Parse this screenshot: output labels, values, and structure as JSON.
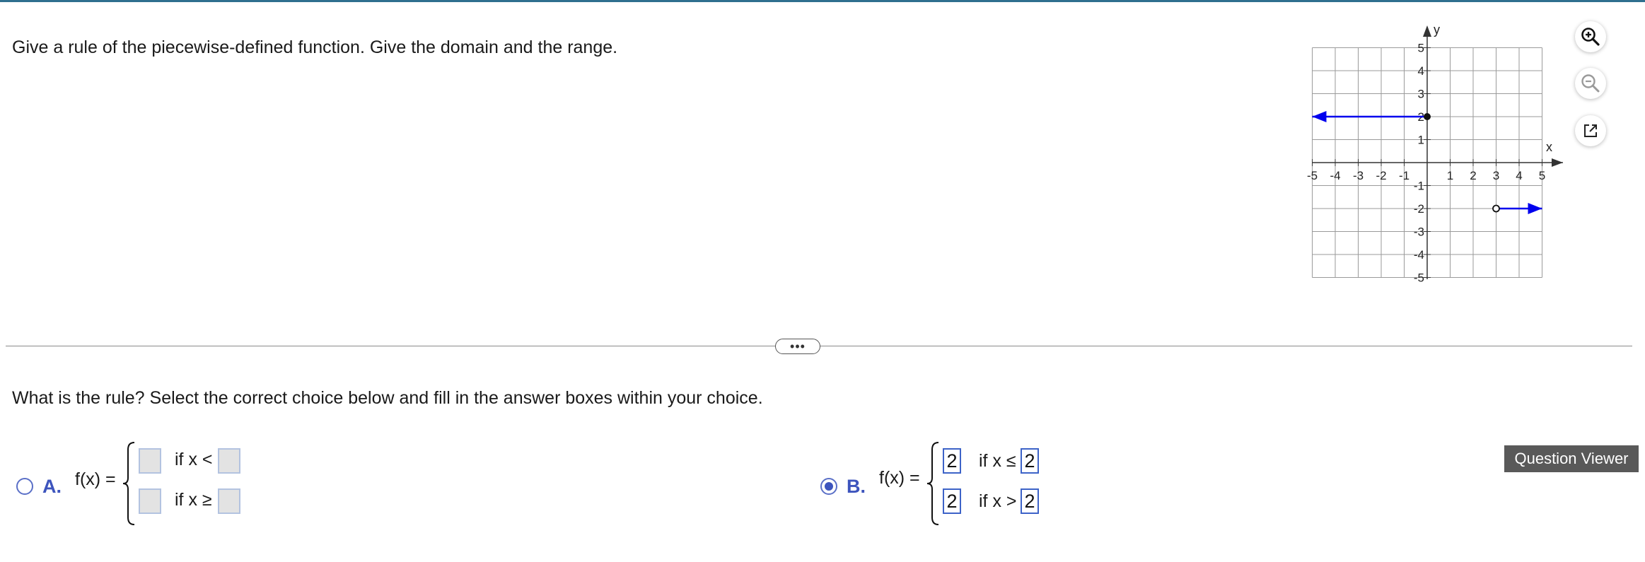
{
  "question": {
    "text": "Give a rule of the piecewise-defined function. Give the domain and the range."
  },
  "graph": {
    "x_axis_label": "x",
    "y_axis_label": "y",
    "x_ticks": [
      "-5",
      "-4",
      "-3",
      "-2",
      "-1",
      "1",
      "2",
      "3",
      "4",
      "5"
    ],
    "y_ticks": [
      "5",
      "4",
      "3",
      "2",
      "1",
      "-1",
      "-2",
      "-3",
      "-4",
      "-5"
    ],
    "segments": [
      {
        "y": 2,
        "x_from": -5,
        "x_to": 0,
        "endpoint": "closed",
        "arrow": "left"
      },
      {
        "y": -2,
        "x_from": 3,
        "x_to": 5,
        "endpoint": "open",
        "arrow": "right"
      }
    ],
    "segment_color": "#0000ee"
  },
  "tools": {
    "zoom_in_icon": "zoom-in-icon",
    "zoom_out_icon": "zoom-out-icon",
    "popout_icon": "external-link-icon"
  },
  "divider": {
    "toggle_label": "•••"
  },
  "prompt": {
    "text": "What is the rule? Select the correct choice below and fill in the answer boxes within your choice."
  },
  "choices": [
    {
      "letter": "A.",
      "fx_label": "f(x) =",
      "selected": false,
      "rows": [
        {
          "value": "",
          "condition": "if x <",
          "bound": ""
        },
        {
          "value": "",
          "condition": "if x ≥",
          "bound": ""
        }
      ]
    },
    {
      "letter": "B.",
      "fx_label": "f(x) =",
      "selected": true,
      "rows": [
        {
          "value": "2",
          "condition": "if x ≤",
          "bound": "2"
        },
        {
          "value": "2",
          "condition": "if x >",
          "bound": "2"
        }
      ]
    }
  ],
  "question_viewer": {
    "label": "Question Viewer"
  },
  "colors": {
    "accent": "#3d54bd",
    "box_border": "#3d63c8",
    "viewer_bg": "#595959"
  }
}
